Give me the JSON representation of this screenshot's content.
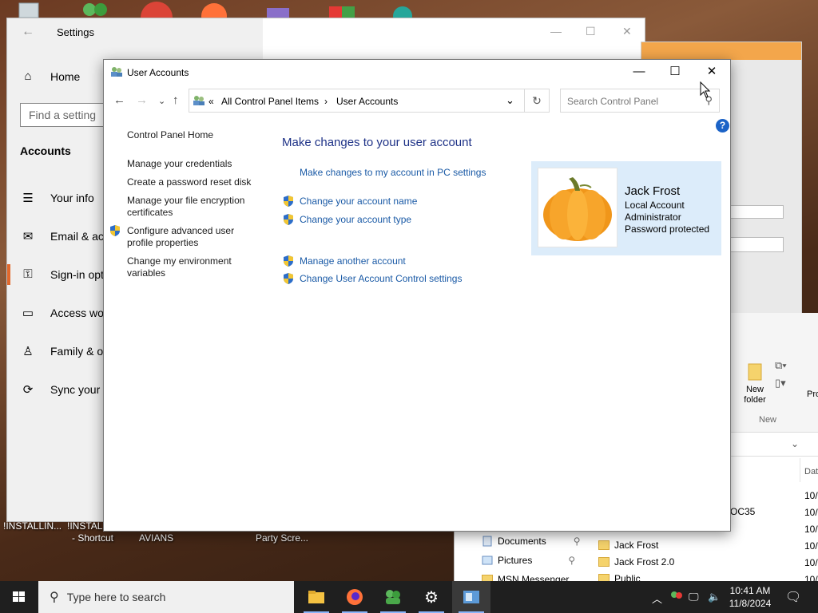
{
  "settings": {
    "title": "Settings",
    "home_label": "Home",
    "search_placeholder": "Find a setting",
    "section_heading": "Accounts",
    "nav": [
      {
        "label": "Your info"
      },
      {
        "label": "Email & acco"
      },
      {
        "label": "Sign-in optio"
      },
      {
        "label": "Access work"
      },
      {
        "label": "Family & oth"
      },
      {
        "label": "Sync your se"
      }
    ]
  },
  "user_accounts": {
    "title": "User Accounts",
    "breadcrumb": [
      "All Control Panel Items",
      "User Accounts"
    ],
    "breadcrumb_overflow": "«",
    "search_placeholder": "Search Control Panel",
    "help_label": "?",
    "sidebar": {
      "home": "Control Panel Home",
      "links": [
        "Manage your credentials",
        "Create a password reset disk",
        "Manage your file encryption certificates",
        "Configure advanced user profile properties",
        "Change my environment variables"
      ]
    },
    "heading": "Make changes to your user account",
    "pc_settings_link": "Make changes to my account in PC settings",
    "tasks": [
      "Change your account name",
      "Change your account type",
      "Manage another account",
      "Change User Account Control settings"
    ],
    "account": {
      "name": "Jack Frost",
      "type": "Local Account",
      "role": "Administrator",
      "password_status": "Password protected"
    }
  },
  "explorer": {
    "ribbon_new_folder": "New folder",
    "ribbon_group": "New",
    "ribbon_pro": "Pro",
    "date_header": "Dat",
    "quick_access": [
      "Documents",
      "Pictures",
      "MSN Messenger"
    ],
    "files": [
      "Jack Frost",
      "Jack Frost 2.0",
      "Public"
    ],
    "partial_label": "OC35",
    "dates": [
      "10/",
      "10/",
      "10/",
      "10/",
      "10/",
      "10/"
    ]
  },
  "desktop_labels": [
    "!INSTALLIN...",
    "!INSTALL",
    "- Shortcut",
    "AVIANS",
    "Party Scre..."
  ],
  "taskbar": {
    "search_placeholder": "Type here to search",
    "time": "10:41 AM",
    "date": "11/8/2024"
  }
}
